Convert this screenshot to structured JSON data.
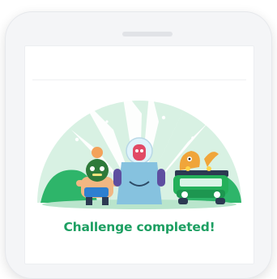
{
  "screen": {
    "caption": "Challenge completed!"
  },
  "colors": {
    "brand_green": "#1d9f62",
    "car_green": "#24b05a",
    "hill_green": "#c9ecd8"
  },
  "icons": [
    "phone-frame",
    "speaker-notch",
    "sunburst",
    "wrestler-character",
    "robot-character",
    "dinosaur-character",
    "green-car"
  ]
}
